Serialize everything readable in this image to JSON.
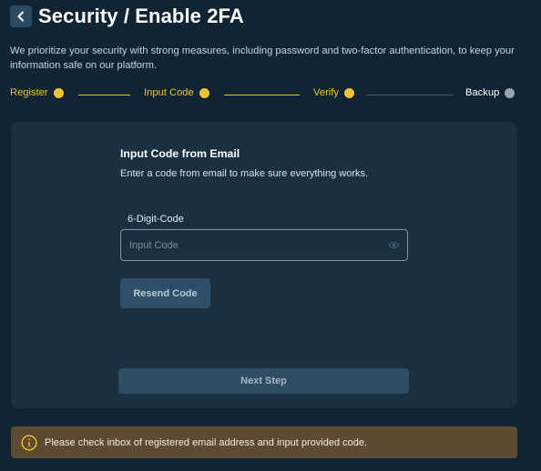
{
  "header": {
    "title": "Security / Enable 2FA",
    "back_icon": "chevron-left-icon"
  },
  "intro": {
    "text": "We prioritize your security with strong measures, including password and two-factor authentication, to keep your information safe on our platform."
  },
  "stepper": {
    "steps": [
      {
        "label": "Register",
        "state": "complete"
      },
      {
        "label": "Input Code",
        "state": "active"
      },
      {
        "label": "Verify",
        "state": "complete"
      },
      {
        "label": "Backup",
        "state": "pending"
      }
    ]
  },
  "card": {
    "heading": "Input Code from Email",
    "subtitle": "Enter a code from email to make sure everything works.",
    "field_label": "6-Digit-Code",
    "input_value": "",
    "input_placeholder": "Input Code",
    "input_icon": "eye-icon",
    "resend_label": "Resend Code",
    "next_label": "Next Step"
  },
  "notice": {
    "icon": "info-icon",
    "text": "Please check inbox of registered email address and input provided code."
  },
  "colors": {
    "background": "#112433",
    "card": "#1a3040",
    "accent": "#f2c12e",
    "pending": "#9aa3aa",
    "notice": "#5e4a33"
  }
}
